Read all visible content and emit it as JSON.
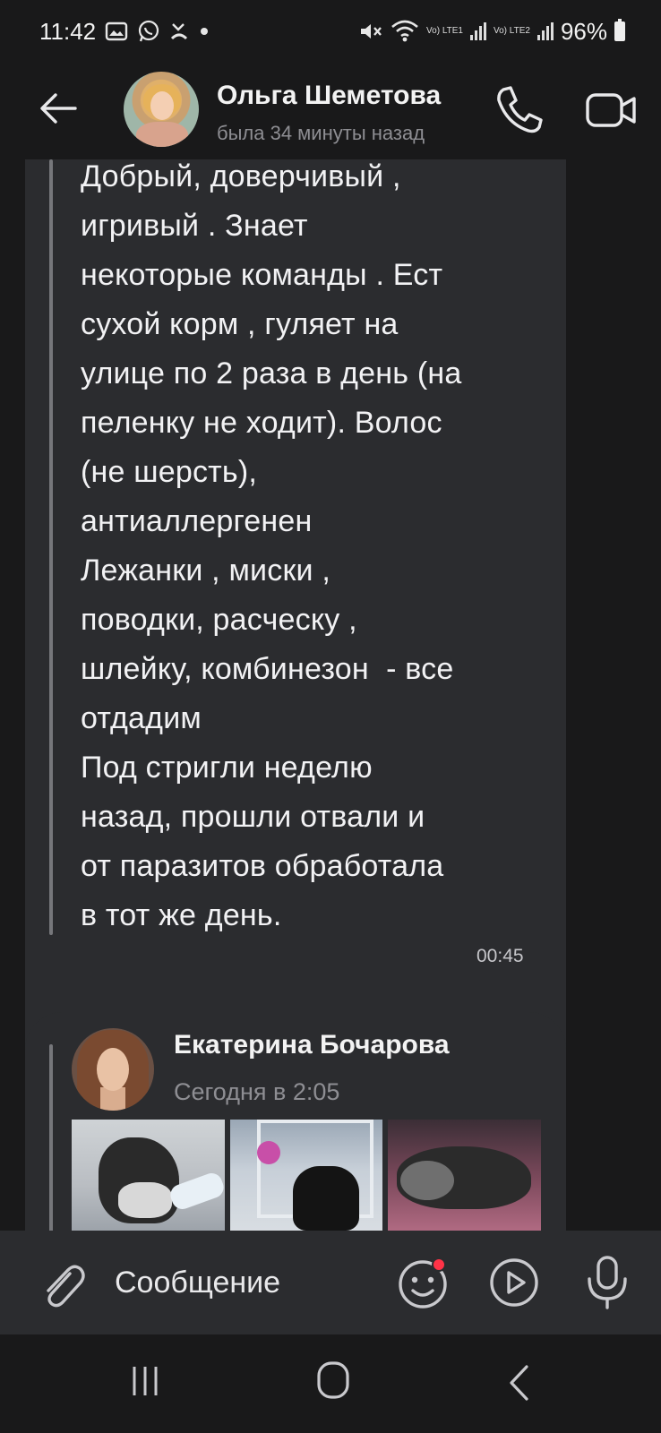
{
  "status_bar": {
    "time": "11:42",
    "left_icons": [
      "gallery-icon",
      "whatsapp-icon",
      "missed-call-icon",
      "dot-icon"
    ],
    "right_icons": [
      "mute-icon",
      "wifi-icon",
      "signal-lte1-icon",
      "signal-lte2-icon",
      "battery-icon"
    ],
    "network1": "Vo) LTE1",
    "network2": "Vo) LTE2",
    "battery": "96%"
  },
  "header": {
    "contact_name": "Ольга Шеметова",
    "contact_status": "была 34 минуты назад",
    "icons": [
      "back-arrow-icon",
      "phone-icon",
      "video-camera-icon"
    ]
  },
  "messages": [
    {
      "text": "Добрый, доверчивый ,\nигривый . Знает\nнекоторые команды . Ест\nсухой корм , гуляет на\nулице по 2 раза в день (на\nпеленку не ходит). Волос\n(не шерсть),\nантиаллергенен\nЛежанки , миски ,\nповодки, расческу ,\nшлейку, комбинезон  - все\nотдадим\nПод стригли неделю\nназад, прошли отвали и\nот паразитов обработала\nв тот же день.",
      "time": "00:45"
    }
  ],
  "forwarded_post": {
    "author": "Екатерина Бочарова",
    "date": "Сегодня в 2:05",
    "photos": [
      "dog-photo-1",
      "dog-photo-2",
      "dog-photo-3"
    ]
  },
  "input_bar": {
    "placeholder": "Сообщение",
    "icons": [
      "paperclip-icon",
      "emoji-icon",
      "video-message-icon",
      "microphone-icon"
    ],
    "notification_dot_color": "#ff3347"
  },
  "nav_bar": {
    "icons": [
      "recents-icon",
      "home-icon",
      "back-icon"
    ]
  },
  "colors": {
    "background": "#19191a",
    "bubble": "#2b2c2f",
    "text": "#f2f2f4",
    "muted": "#8e8e93"
  }
}
